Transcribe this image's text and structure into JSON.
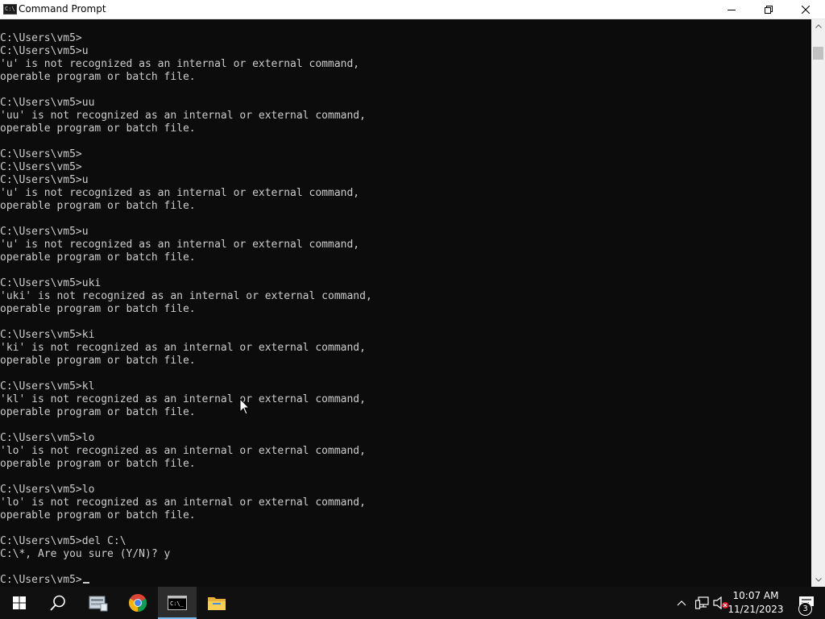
{
  "window": {
    "title": "Command Prompt",
    "app_icon_text": "C:\\"
  },
  "console": {
    "lines": [
      "C:\\Users\\vm5>",
      "C:\\Users\\vm5>u",
      "'u' is not recognized as an internal or external command,",
      "operable program or batch file.",
      "",
      "C:\\Users\\vm5>uu",
      "'uu' is not recognized as an internal or external command,",
      "operable program or batch file.",
      "",
      "C:\\Users\\vm5>",
      "C:\\Users\\vm5>",
      "C:\\Users\\vm5>u",
      "'u' is not recognized as an internal or external command,",
      "operable program or batch file.",
      "",
      "C:\\Users\\vm5>u",
      "'u' is not recognized as an internal or external command,",
      "operable program or batch file.",
      "",
      "C:\\Users\\vm5>uki",
      "'uki' is not recognized as an internal or external command,",
      "operable program or batch file.",
      "",
      "C:\\Users\\vm5>ki",
      "'ki' is not recognized as an internal or external command,",
      "operable program or batch file.",
      "",
      "C:\\Users\\vm5>kl",
      "'kl' is not recognized as an internal or external command,",
      "operable program or batch file.",
      "",
      "C:\\Users\\vm5>lo",
      "'lo' is not recognized as an internal or external command,",
      "operable program or batch file.",
      "",
      "C:\\Users\\vm5>lo",
      "'lo' is not recognized as an internal or external command,",
      "operable program or batch file.",
      "",
      "C:\\Users\\vm5>del C:\\",
      "C:\\*, Are you sure (Y/N)? y",
      ""
    ],
    "prompt": "C:\\Users\\vm5>"
  },
  "taskbar": {
    "items": [
      {
        "name": "start",
        "icon": "windows-logo-icon"
      },
      {
        "name": "search",
        "icon": "search-icon"
      },
      {
        "name": "server-manager",
        "icon": "server-manager-icon"
      },
      {
        "name": "chrome",
        "icon": "chrome-icon"
      },
      {
        "name": "command-prompt",
        "icon": "command-prompt-icon",
        "active": true
      },
      {
        "name": "file-explorer",
        "icon": "folder-icon"
      }
    ],
    "tray": {
      "clock_time": "10:07 AM",
      "clock_date": "11/21/2023",
      "notification_count": "3"
    }
  },
  "colors": {
    "console_bg": "#0c0c0c",
    "console_fg": "#cccccc",
    "taskbar_bg": "#101010",
    "active_indicator": "#76b9ed"
  }
}
